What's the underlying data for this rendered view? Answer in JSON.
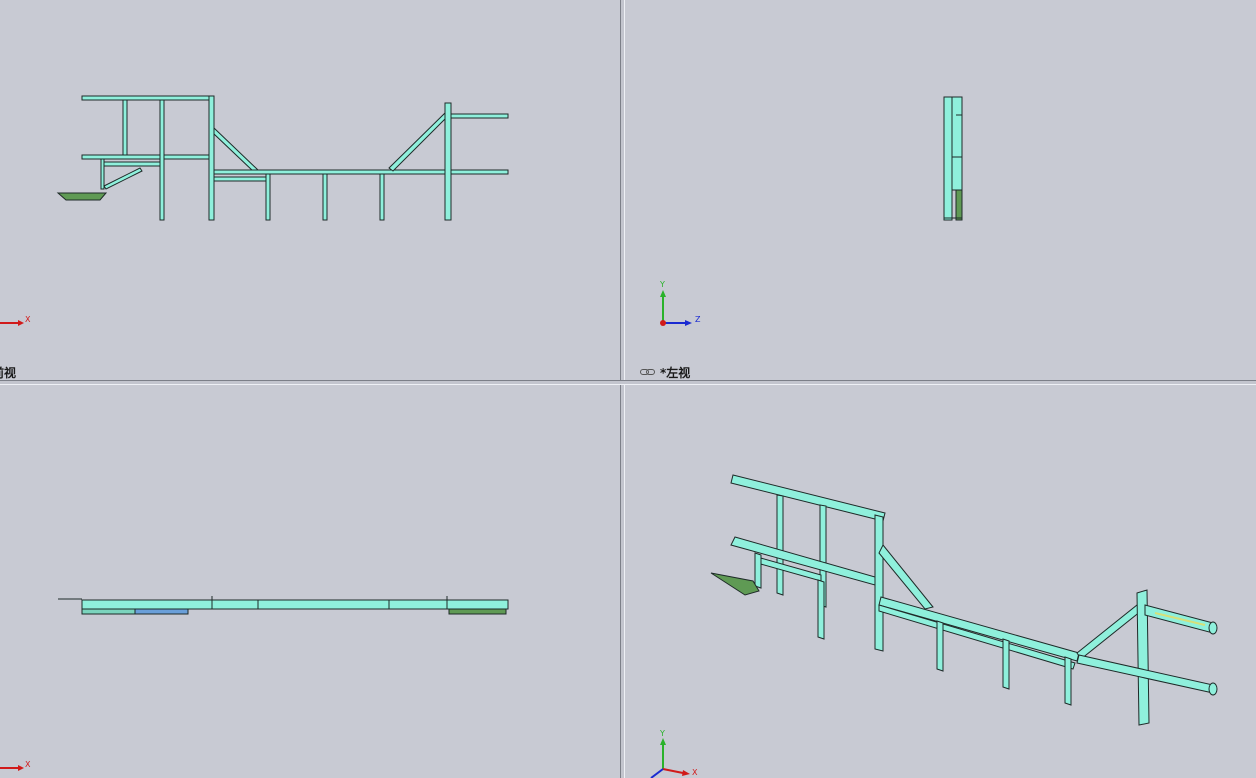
{
  "viewports": {
    "front": {
      "label": "前视"
    },
    "left": {
      "label": "*左视"
    },
    "top": {
      "label": ""
    },
    "iso": {
      "label": ""
    }
  },
  "triads": {
    "front": {
      "x": "X"
    },
    "left": {
      "y": "Y",
      "z": "Z"
    },
    "top": {
      "x": "X"
    },
    "iso": {
      "y": "Y",
      "x": "X"
    }
  },
  "icons": {
    "view_link": "linked-views-icon"
  },
  "colors": {
    "background": "#c8cad3",
    "frame_fill": "#8ff0dc",
    "frame_edge": "#1e2a28",
    "plate_fill": "#5f9a54",
    "axis_x": "#d11a1a",
    "axis_y": "#2ab22a",
    "axis_z": "#1a2ad1"
  }
}
